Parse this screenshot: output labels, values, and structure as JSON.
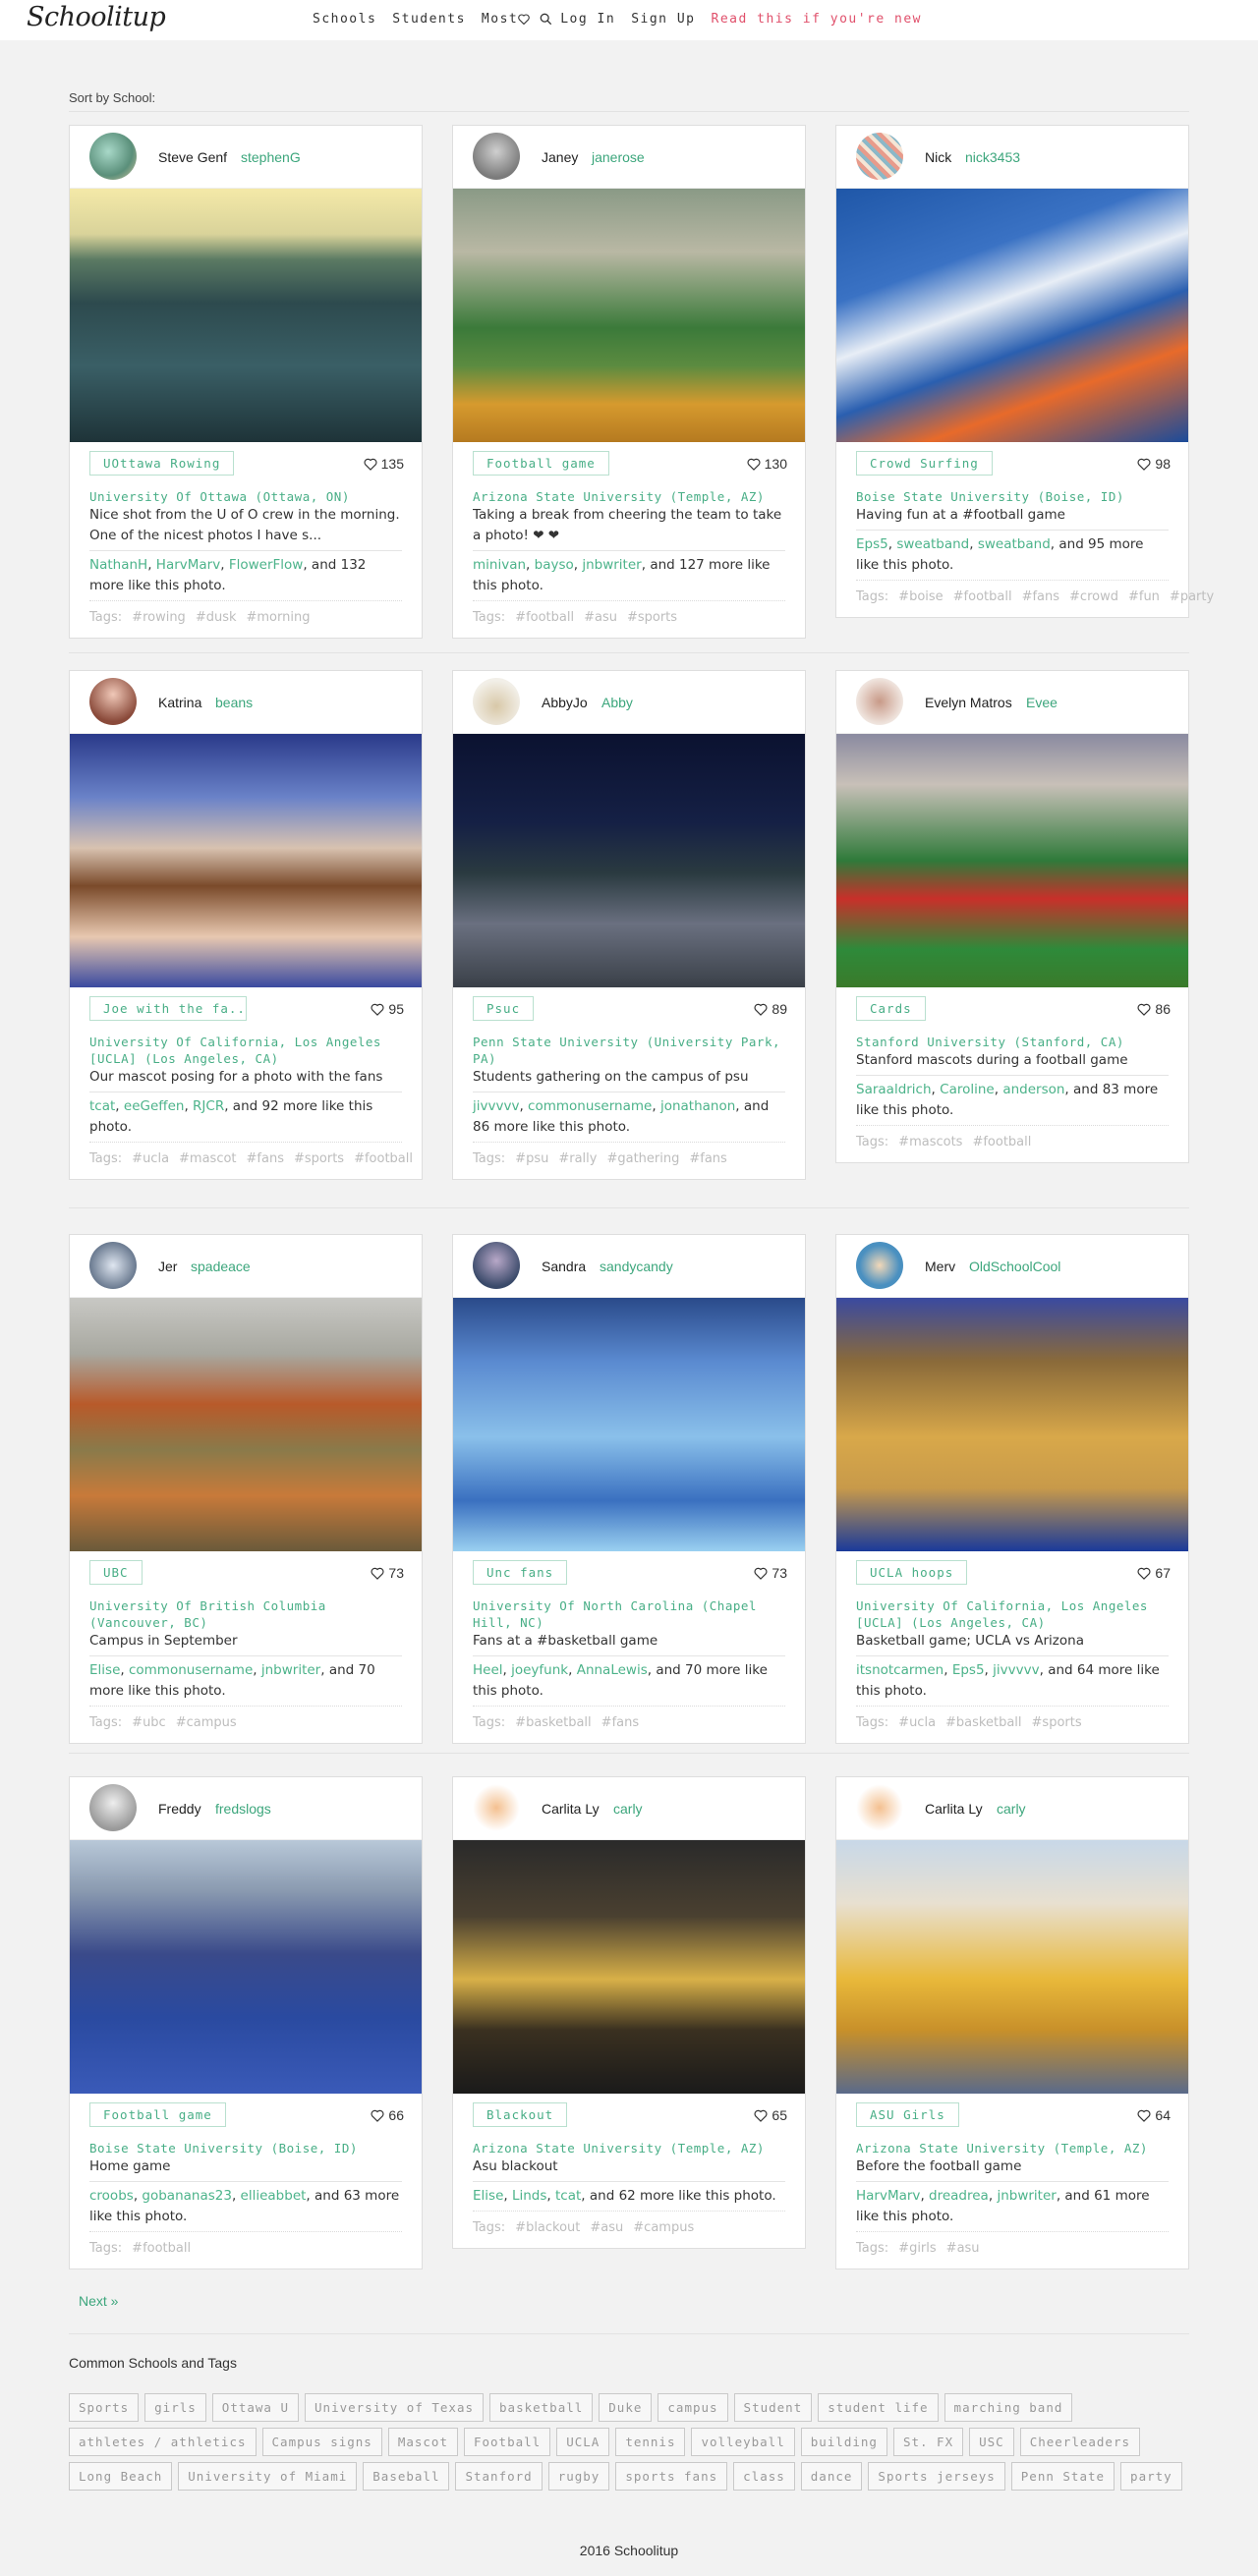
{
  "header": {
    "logo": "Schoolitup",
    "nav": [
      "Schools",
      "Students"
    ],
    "most": "Most",
    "login": "Log In",
    "signup": "Sign Up",
    "new_link": "Read this if you're new"
  },
  "sort_label": "Sort by School:",
  "cards": [
    {
      "name": "Steve Genf",
      "handle": "stephenG",
      "tag": "UOttawa Rowing",
      "likes": "135",
      "school": "University Of Ottawa (Ottawa, ON)",
      "caption": "Nice shot from the U of O crew in the morning. One of the nicest photos I have s...",
      "likers": [
        "NathanH",
        "HarvMarv",
        "FlowerFlow"
      ],
      "more_count": "and 132 more like this photo.",
      "hashtags": [
        "#rowing",
        "#dusk",
        "#morning"
      ]
    },
    {
      "name": "Janey",
      "handle": "janerose",
      "tag": "Football game",
      "likes": "130",
      "school": "Arizona State University (Temple, AZ)",
      "caption": "Taking a break from cheering the team to take a photo! ❤ ❤",
      "likers": [
        "minivan",
        "bayso",
        "jnbwriter"
      ],
      "more_count": "and 127 more like this photo.",
      "hashtags": [
        "#football",
        "#asu",
        "#sports"
      ]
    },
    {
      "name": "Nick",
      "handle": "nick3453",
      "tag": "Crowd Surfing",
      "likes": "98",
      "school": "Boise State University (Boise, ID)",
      "caption": "Having fun at a #football game",
      "likers": [
        "Eps5",
        "sweatband",
        "sweatband"
      ],
      "more_count": "and 95 more like this photo.",
      "hashtags": [
        "#boise",
        "#football",
        "#fans",
        "#crowd",
        "#fun",
        "#party"
      ]
    },
    {
      "name": "Katrina",
      "handle": "beans",
      "tag": "Joe with the fa...",
      "likes": "95",
      "school": "University Of California, Los Angeles [UCLA] (Los Angeles, CA)",
      "caption": "Our mascot posing for a photo with the fans",
      "likers": [
        "tcat",
        "eeGeffen",
        "RJCR"
      ],
      "more_count": "and 92 more like this photo.",
      "hashtags": [
        "#ucla",
        "#mascot",
        "#fans",
        "#sports",
        "#football"
      ]
    },
    {
      "name": "AbbyJo",
      "handle": "Abby",
      "tag": "Psuc",
      "likes": "89",
      "school": "Penn State University (University Park, PA)",
      "caption": "Students gathering on the campus of psu",
      "likers": [
        "jivvvvv",
        "commonusername",
        "jonathanon"
      ],
      "more_count": "and 86 more like this photo.",
      "hashtags": [
        "#psu",
        "#rally",
        "#gathering",
        "#fans"
      ]
    },
    {
      "name": "Evelyn Matros",
      "handle": "Evee",
      "tag": "Cards",
      "likes": "86",
      "school": "Stanford University (Stanford, CA)",
      "caption": "Stanford mascots during a football game",
      "likers": [
        "Saraaldrich",
        "Caroline",
        "anderson"
      ],
      "more_count": "and 83 more like this photo.",
      "hashtags": [
        "#mascots",
        "#football"
      ]
    },
    {
      "name": "Jer",
      "handle": "spadeace",
      "tag": "UBC",
      "likes": "73",
      "school": "University Of British Columbia (Vancouver, BC)",
      "caption": "Campus in September",
      "likers": [
        "Elise",
        "commonusername",
        "jnbwriter"
      ],
      "more_count": "and 70 more like this photo.",
      "hashtags": [
        "#ubc",
        "#campus"
      ]
    },
    {
      "name": "Sandra",
      "handle": "sandycandy",
      "tag": "Unc fans",
      "likes": "73",
      "school": "University Of North Carolina (Chapel Hill, NC)",
      "caption": "Fans at a #basketball game",
      "likers": [
        "Heel",
        "joeyfunk",
        "AnnaLewis"
      ],
      "more_count": "and 70 more like this photo.",
      "hashtags": [
        "#basketball",
        "#fans"
      ]
    },
    {
      "name": "Merv",
      "handle": "OldSchoolCool",
      "tag": "UCLA hoops",
      "likes": "67",
      "school": "University Of California, Los Angeles [UCLA] (Los Angeles, CA)",
      "caption": "Basketball game; UCLA vs Arizona",
      "likers": [
        "itsnotcarmen",
        "Eps5",
        "jivvvvv"
      ],
      "more_count": "and 64 more like this photo.",
      "hashtags": [
        "#ucla",
        "#basketball",
        "#sports"
      ]
    },
    {
      "name": "Freddy",
      "handle": "fredslogs",
      "tag": "Football game",
      "likes": "66",
      "school": "Boise State University (Boise, ID)",
      "caption": "Home game",
      "likers": [
        "croobs",
        "gobananas23",
        "ellieabbet"
      ],
      "more_count": "and 63 more like this photo.",
      "hashtags": [
        "#football"
      ]
    },
    {
      "name": "Carlita Ly",
      "handle": "carly",
      "tag": "Blackout",
      "likes": "65",
      "school": "Arizona State University (Temple, AZ)",
      "caption": "Asu blackout",
      "likers": [
        "Elise",
        "Linds",
        "tcat"
      ],
      "more_count": "and 62 more like this photo.",
      "hashtags": [
        "#blackout",
        "#asu",
        "#campus"
      ]
    },
    {
      "name": "Carlita Ly",
      "handle": "carly",
      "tag": "ASU Girls",
      "likes": "64",
      "school": "Arizona State University (Temple, AZ)",
      "caption": "Before the football game",
      "likers": [
        "HarvMarv",
        "dreadrea",
        "jnbwriter"
      ],
      "more_count": "and 61 more like this photo.",
      "hashtags": [
        "#girls",
        "#asu"
      ]
    }
  ],
  "tags_label": "Tags:",
  "next_label": "Next »",
  "common_heading": "Common Schools and Tags",
  "common_tags": [
    "Sports",
    "girls",
    "Ottawa U",
    "University of Texas",
    "basketball",
    "Duke",
    "campus",
    "Student",
    "student life",
    "marching band",
    "athletes / athletics",
    "Campus signs",
    "Mascot",
    "Football",
    "UCLA",
    "tennis",
    "volleyball",
    "building",
    "St. FX",
    "USC",
    "Cheerleaders",
    "Long Beach",
    "University of Miami",
    "Baseball",
    "Stanford",
    "rugby",
    "sports fans",
    "class",
    "dance",
    "Sports jerseys",
    "Penn State",
    "party"
  ],
  "footer": "2016 Schoolitup",
  "colors": {
    "accent": "#3ca67c",
    "new_link": "#e0506b"
  }
}
